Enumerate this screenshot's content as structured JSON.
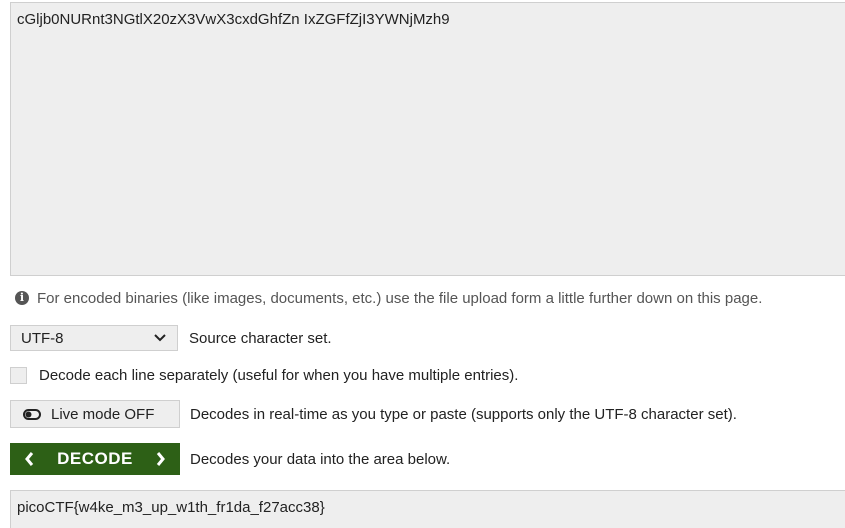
{
  "input": {
    "value": "cGljb0NURnt3NGtlX20zX3VwX3cxdGhfZn IxZGFfZjI3YWNjMzh9"
  },
  "info": {
    "icon": "info-icon",
    "text": "For encoded binaries (like images, documents, etc.) use the file upload form a little further down on this page."
  },
  "charset": {
    "selected": "UTF-8",
    "label": "Source character set."
  },
  "each_line": {
    "checked": false,
    "label": "Decode each line separately (useful for when you have multiple entries)."
  },
  "live_mode": {
    "button_label": "Live mode OFF",
    "description": "Decodes in real-time as you type or paste (supports only the UTF-8 character set)."
  },
  "decode": {
    "button_label": "DECODE",
    "description": "Decodes your data into the area below.",
    "color": "#2d6016"
  },
  "output": {
    "value": "picoCTF{w4ke_m3_up_w1th_fr1da_f27acc38}"
  }
}
